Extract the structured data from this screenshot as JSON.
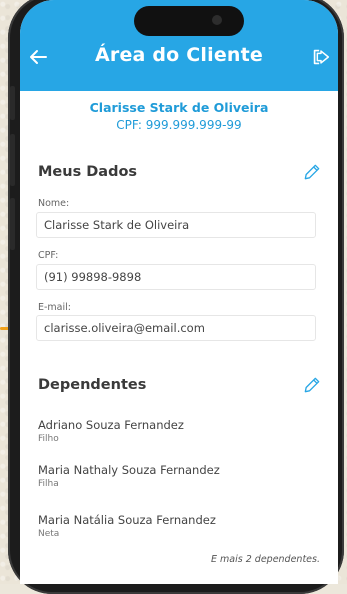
{
  "header": {
    "title": "Área do Cliente",
    "back_icon": "arrow-left-icon",
    "logout_icon": "logout-icon",
    "color": "#27a6e5"
  },
  "client": {
    "name": "Clarisse Stark de Oliveira",
    "cpf": "CPF: 999.999.999-99"
  },
  "meus_dados": {
    "title": "Meus Dados",
    "edit_icon": "pencil-icon",
    "fields": [
      {
        "label": "Nome:",
        "value": "Clarisse Stark de Oliveira"
      },
      {
        "label": "CPF:",
        "value": "(91) 99898-9898"
      },
      {
        "label": "E-mail:",
        "value": "clarisse.oliveira@email.com"
      }
    ]
  },
  "dependentes": {
    "title": "Dependentes",
    "edit_icon": "pencil-icon",
    "items": [
      {
        "name": "Adriano Souza Fernandez",
        "relation": "Filho"
      },
      {
        "name": "Maria Nathaly Souza Fernandez",
        "relation": "Filha"
      },
      {
        "name": "Maria Natália Souza Fernandez",
        "relation": "Neta"
      }
    ],
    "more": "E mais 2 dependentes."
  },
  "colors": {
    "accent": "#27a6e5",
    "highlight": "#f2a21b"
  }
}
